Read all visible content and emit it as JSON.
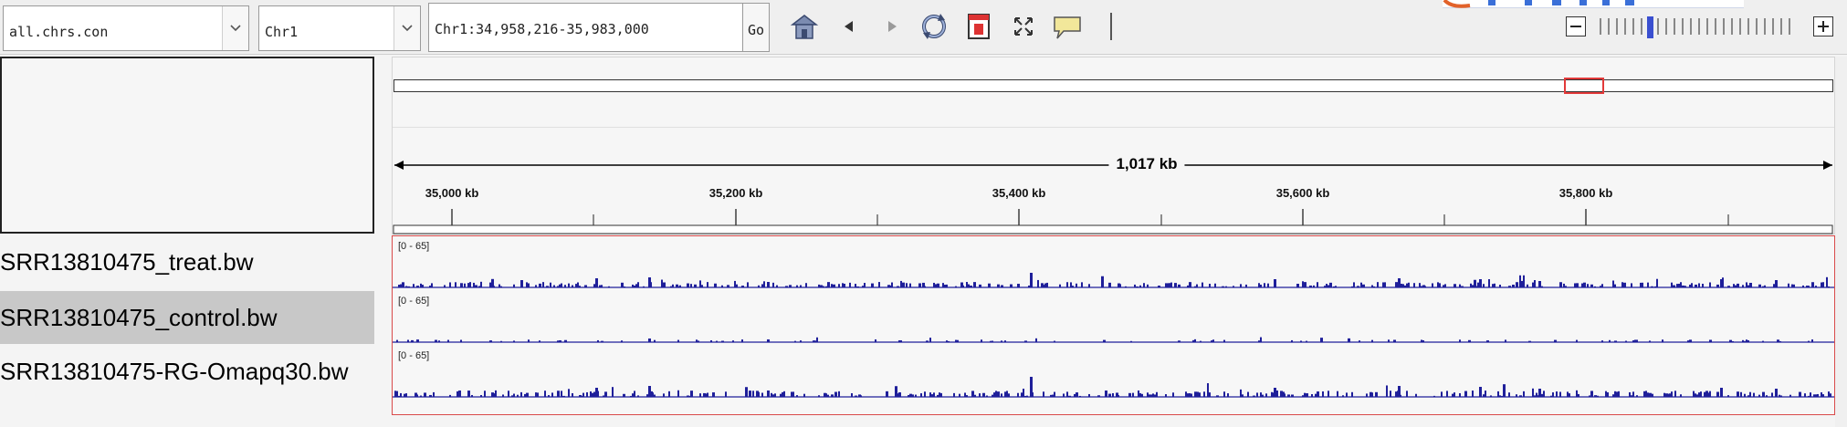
{
  "toolbar": {
    "genome": "all.chrs.con",
    "chromosome": "Chr1",
    "locus": "Chr1:34,958,216-35,983,000",
    "go_label": "Go"
  },
  "ruler": {
    "span_label": "1,017 kb",
    "ticks": [
      "35,000 kb",
      "35,200 kb",
      "35,400 kb",
      "35,600 kb",
      "35,800 kb"
    ]
  },
  "tracks": [
    {
      "name": "SRR13810475_treat.bw",
      "range": "[0 - 65]",
      "selected": false
    },
    {
      "name": "SRR13810475_control.bw",
      "range": "[0 - 65]",
      "selected": true
    },
    {
      "name": "SRR13810475-RG-Omapq30.bw",
      "range": "[0 - 65]",
      "selected": false
    }
  ],
  "colors": {
    "signal": "#1f1f9a",
    "region_box": "#e23a3a",
    "panel_border": "#d94a4a",
    "zoom_current": "#3a4fd0"
  },
  "icons": [
    "home-icon",
    "back-icon",
    "forward-icon",
    "refresh-icon",
    "region-of-interest-icon",
    "resize-icon",
    "popup-info-icon",
    "zoom-out-icon",
    "zoom-in-icon"
  ]
}
